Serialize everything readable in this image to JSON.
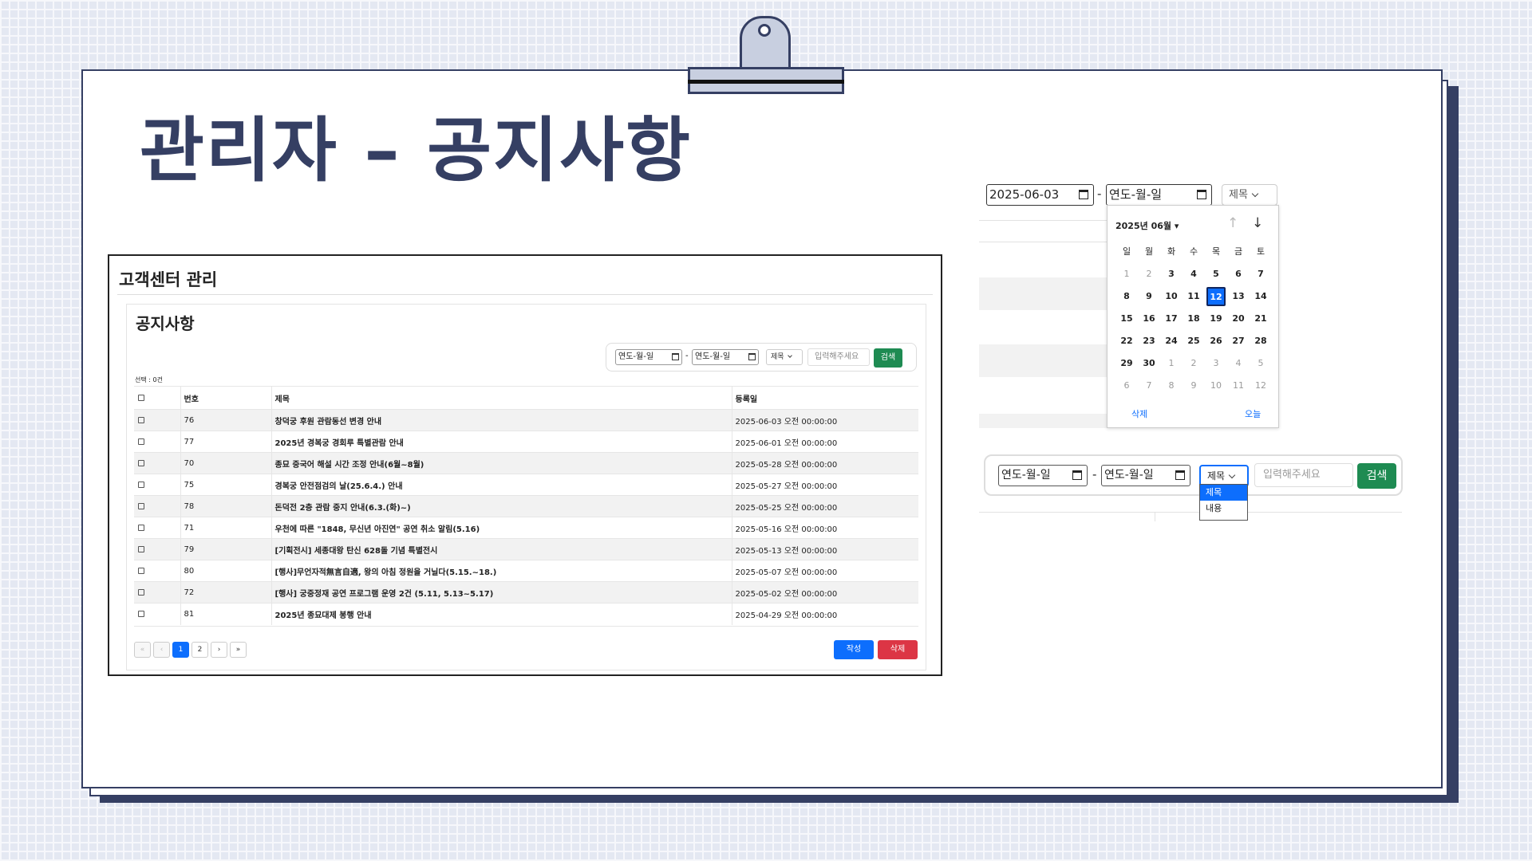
{
  "slide": {
    "title": "관리자 – 공지사항"
  },
  "admin": {
    "page_title": "고객센터 관리",
    "section_title": "공지사항",
    "search": {
      "date_placeholder": "연도-월-일",
      "dash": "-",
      "select_value": "제목",
      "keyword_placeholder": "입력해주세요",
      "button": "검색"
    },
    "selected_count": "선택 : 0건",
    "columns": [
      "번호",
      "제목",
      "등록일"
    ],
    "rows": [
      {
        "num": "76",
        "title": "창덕궁 후원 관람동선 변경 안내",
        "date": "2025-06-03 오전 00:00:00"
      },
      {
        "num": "77",
        "title": "2025년 경복궁 경회루 특별관람 안내",
        "date": "2025-06-01 오전 00:00:00"
      },
      {
        "num": "70",
        "title": "종묘 중국어 해설 시간 조정 안내(6월~8월)",
        "date": "2025-05-28 오전 00:00:00"
      },
      {
        "num": "75",
        "title": "경복궁 안전점검의 날(25.6.4.) 안내",
        "date": "2025-05-27 오전 00:00:00"
      },
      {
        "num": "78",
        "title": "돈덕전 2층 관람 중지 안내(6.3.(화)~)",
        "date": "2025-05-25 오전 00:00:00"
      },
      {
        "num": "71",
        "title": "우천에 따른 \"1848, 무신년 아진연\" 공연 취소 알림(5.16)",
        "date": "2025-05-16 오전 00:00:00"
      },
      {
        "num": "79",
        "title": "[기획전시] 세종대왕 탄신 628돌 기념 특별전시",
        "date": "2025-05-13 오전 00:00:00"
      },
      {
        "num": "80",
        "title": "[행사]무언자적無言自適, 왕의 아침 정원을 거닐다(5.15.~18.)",
        "date": "2025-05-07 오전 00:00:00"
      },
      {
        "num": "72",
        "title": "[행사] 궁중정재 공연 프로그램 운영 2건 (5.11, 5.13~5.17)",
        "date": "2025-05-02 오전 00:00:00"
      },
      {
        "num": "81",
        "title": "2025년 종묘대제 봉행 안내",
        "date": "2025-04-29 오전 00:00:00"
      }
    ],
    "pager": {
      "first": "«",
      "prev": "‹",
      "pages": [
        "1",
        "2"
      ],
      "next": "›",
      "last": "»",
      "current": "1"
    },
    "write_button": "작성",
    "delete_button": "삭제"
  },
  "calendar_detail": {
    "start_date": "2025-06-03",
    "end_placeholder": "연도-월-일",
    "dash": "-",
    "select_value": "제목",
    "month_label": "2025년 06월 ▾",
    "prev_arrow": "↑",
    "next_arrow": "↓",
    "weekdays": [
      "일",
      "월",
      "화",
      "수",
      "목",
      "금",
      "토"
    ],
    "days": [
      {
        "d": "1",
        "m": true
      },
      {
        "d": "2",
        "m": true
      },
      {
        "d": "3"
      },
      {
        "d": "4"
      },
      {
        "d": "5"
      },
      {
        "d": "6"
      },
      {
        "d": "7"
      },
      {
        "d": "8"
      },
      {
        "d": "9"
      },
      {
        "d": "10"
      },
      {
        "d": "11"
      },
      {
        "d": "12",
        "today": true
      },
      {
        "d": "13"
      },
      {
        "d": "14"
      },
      {
        "d": "15"
      },
      {
        "d": "16"
      },
      {
        "d": "17"
      },
      {
        "d": "18"
      },
      {
        "d": "19"
      },
      {
        "d": "20"
      },
      {
        "d": "21"
      },
      {
        "d": "22"
      },
      {
        "d": "23"
      },
      {
        "d": "24"
      },
      {
        "d": "25"
      },
      {
        "d": "26"
      },
      {
        "d": "27"
      },
      {
        "d": "28"
      },
      {
        "d": "29"
      },
      {
        "d": "30"
      },
      {
        "d": "1",
        "m": true
      },
      {
        "d": "2",
        "m": true
      },
      {
        "d": "3",
        "m": true
      },
      {
        "d": "4",
        "m": true
      },
      {
        "d": "5",
        "m": true
      },
      {
        "d": "6",
        "m": true
      },
      {
        "d": "7",
        "m": true
      },
      {
        "d": "8",
        "m": true
      },
      {
        "d": "9",
        "m": true
      },
      {
        "d": "10",
        "m": true
      },
      {
        "d": "11",
        "m": true
      },
      {
        "d": "12",
        "m": true
      }
    ],
    "clear": "삭제",
    "today": "오늘"
  },
  "dropdown_detail": {
    "date_placeholder": "연도-월-일",
    "dash": "-",
    "select_value": "제목",
    "keyword_placeholder": "입력해주세요",
    "button": "검색",
    "options": [
      "제목",
      "내용"
    ],
    "selected_option": "제목"
  },
  "colors": {
    "navy": "#353f63",
    "primary": "#0d6efd",
    "success": "#1e8b52",
    "danger": "#dc3545"
  }
}
